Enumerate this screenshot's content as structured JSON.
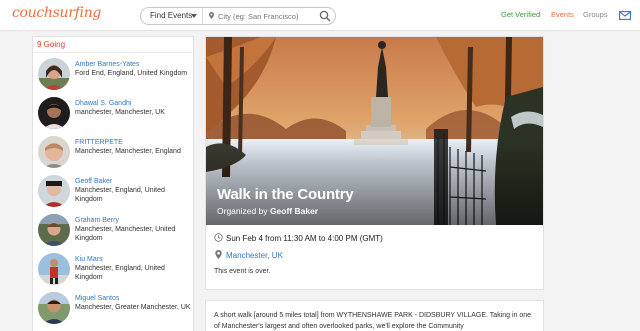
{
  "brand": {
    "logo_text": "couchsurfing",
    "accent": "#f26d3d"
  },
  "search": {
    "mode_label": "Find Events",
    "city_placeholder": "City (eg: San Francisco)"
  },
  "nav": {
    "verified": "Get Verified",
    "events": "Events",
    "groups": "Groups"
  },
  "going": {
    "title": "9 Going",
    "attendees": [
      {
        "name": "Amber Barnes-Yates",
        "location": "Ford End, England, United Kingdom"
      },
      {
        "name": "Dhawal S. Gandhi",
        "location": "manchester, Manchester, UK"
      },
      {
        "name": "FRITTERPETE",
        "location": "Manchester, Manchester, England"
      },
      {
        "name": "Geoff Baker",
        "location": "Manchester, England, United Kingdom"
      },
      {
        "name": "Graham Berry",
        "location": "Manchester, Manchester, United Kingdom"
      },
      {
        "name": "Kiu Mars",
        "location": "Manchester, England, United Kingdom"
      },
      {
        "name": "Miguel Santos",
        "location": "Manchester, Greater Manchester, UK"
      }
    ]
  },
  "event": {
    "title": "Walk in the Country",
    "organized_prefix": "Organized by",
    "organizer": "Geoff Baker",
    "datetime": "Sun Feb 4 from 11:30 AM to 4:00 PM (GMT)",
    "location": "Manchester, UK",
    "status": "This event is over."
  },
  "description": {
    "text": "A short walk [around 5 miles total] from WYTHENSHAWE PARK - DIDSBURY VILLAGE. Taking in one of Manchester's largest and often overlooked parks, we'll explore the Community"
  }
}
